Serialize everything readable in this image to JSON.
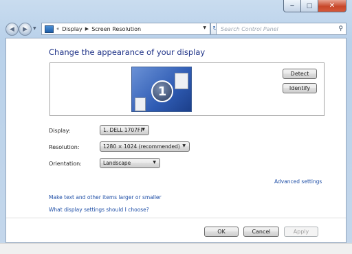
{
  "window": {
    "minimize_glyph": "‒",
    "maximize_glyph": "□",
    "close_glyph": "✕"
  },
  "nav": {
    "back_glyph": "◀",
    "forward_glyph": "▶",
    "breadcrumb_prefix": "«",
    "breadcrumbs": [
      "Display",
      "Screen Resolution"
    ],
    "breadcrumb_separator": "▶",
    "refresh_glyph": "↻",
    "search_placeholder": "Search Control Panel",
    "search_icon": "magnifier-icon"
  },
  "main": {
    "heading": "Change the appearance of your display",
    "monitor_number": "1",
    "detect_label": "Detect",
    "identify_label": "Identify",
    "display_label": "Display:",
    "display_value": "1. DELL 1707FP",
    "resolution_label": "Resolution:",
    "resolution_value": "1280 × 1024 (recommended)",
    "orientation_label": "Orientation:",
    "orientation_value": "Landscape",
    "advanced_link": "Advanced settings",
    "text_size_link": "Make text and other items larger or smaller",
    "help_link": "What display settings should I choose?"
  },
  "footer": {
    "ok_label": "OK",
    "cancel_label": "Cancel",
    "apply_label": "Apply"
  },
  "colors": {
    "heading": "#1e3287",
    "link": "#1e4ea6",
    "frame": "#b9d1ea",
    "close_button": "#c7472a"
  }
}
